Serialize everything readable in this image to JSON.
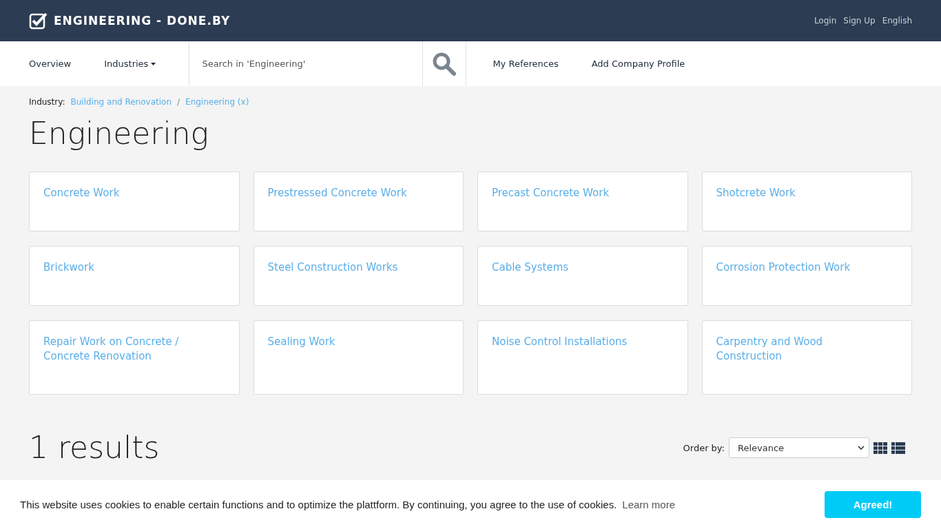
{
  "header": {
    "logo": "ENGINEERING - DONE.BY",
    "links": [
      "Login",
      "Sign Up",
      "English"
    ]
  },
  "nav": {
    "items": [
      {
        "label": "Overview",
        "kind": "link"
      },
      {
        "label": "Industries",
        "kind": "dropdown"
      }
    ],
    "search": {
      "placeholder": "Search in 'Engineering'"
    },
    "links": [
      "My References",
      "Add Company Profile"
    ]
  },
  "breadcrumb": {
    "label": "Industry:",
    "separator": "/",
    "items": [
      "Building and Renovation",
      "Engineering (x)"
    ]
  },
  "title": "Engineering",
  "categories": [
    "Concrete Work",
    "Prestressed Concrete Work",
    "Precast Concrete Work",
    "Shotcrete Work",
    "Brickwork",
    "Steel Construction Works",
    "Cable Systems",
    "Corrosion Protection Work",
    "Repair Work on Concrete / Concrete Renovation",
    "Sealing Work",
    "Noise Control Installations",
    "Carpentry and Wood Construction"
  ],
  "results": {
    "count": "1 results",
    "order_label": "Order by:",
    "order_value": "Relevance",
    "views": [
      {
        "kind": "grid"
      },
      {
        "kind": "list"
      }
    ]
  },
  "cookie": {
    "text": "This website uses cookies to enable certain functions and to optimize the plattform. By continuing, you agree to the use of cookies.",
    "link": "Learn more",
    "button": "Agreed!"
  }
}
